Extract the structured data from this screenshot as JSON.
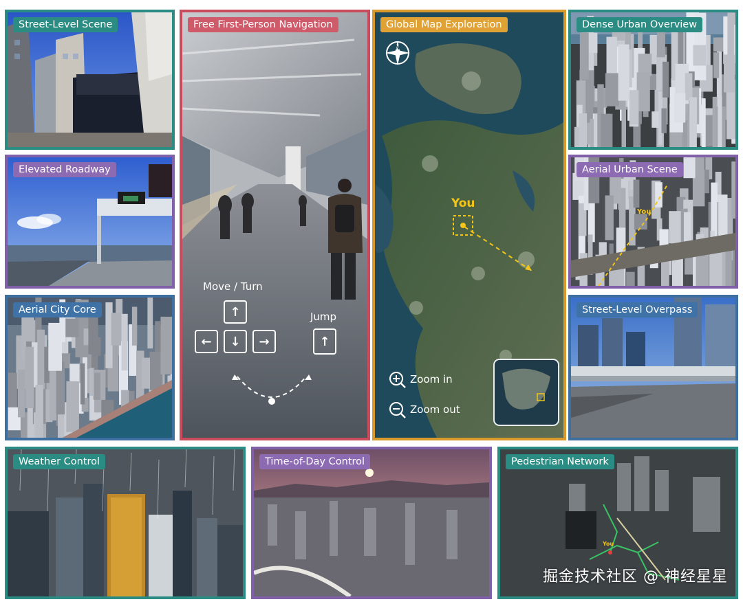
{
  "panels": {
    "street_level_scene": {
      "label": "Street-Level Scene"
    },
    "elevated_roadway": {
      "label": "Elevated Roadway"
    },
    "aerial_city_core": {
      "label": "Aerial City Core"
    },
    "first_person_nav": {
      "label": "Free First-Person Navigation",
      "move_turn_label": "Move / Turn",
      "jump_label": "Jump",
      "keys": {
        "up": "↑",
        "left": "←",
        "down": "↓",
        "right": "→",
        "jump": "↑"
      }
    },
    "global_map": {
      "label": "Global Map Exploration",
      "compass_letter": "N",
      "you_marker": "You",
      "zoom_in_label": "Zoom in",
      "zoom_out_label": "Zoom out"
    },
    "dense_urban_overview": {
      "label": "Dense Urban Overview"
    },
    "aerial_urban_scene": {
      "label": "Aerial Urban Scene",
      "you_marker": "You"
    },
    "street_level_overpass": {
      "label": "Street-Level Overpass"
    },
    "weather_control": {
      "label": "Weather Control"
    },
    "time_of_day_control": {
      "label": "Time-of-Day Control"
    },
    "pedestrian_network": {
      "label": "Pedestrian Network",
      "you_marker": "You"
    }
  },
  "watermark": "掘金技术社区 @ 神经星星",
  "colors": {
    "teal": "#2a8c82",
    "purple": "#8060a8",
    "blue": "#3d6fa0",
    "red": "#c84c5e",
    "orange": "#d99a2b",
    "marker_yellow": "#f2c518"
  }
}
